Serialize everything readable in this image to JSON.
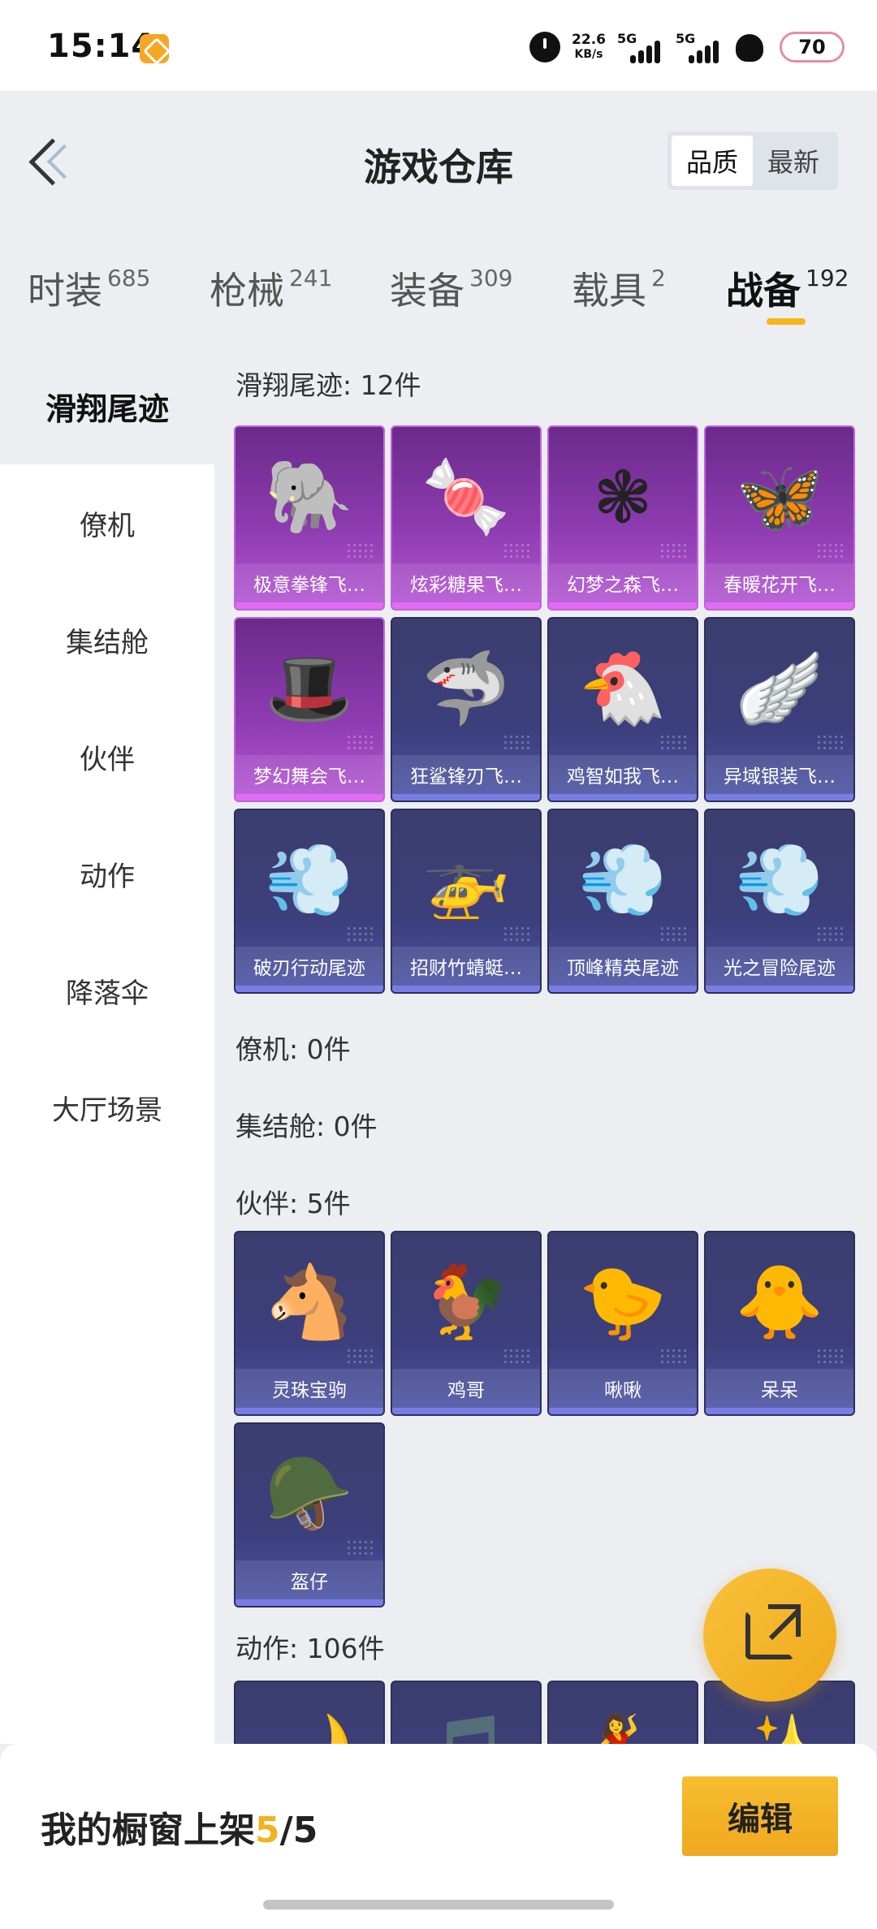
{
  "status_bar": {
    "time": "15:14",
    "speed_value": "22.6",
    "speed_unit": "KB/s",
    "sig1": "5G",
    "sig2": "5G",
    "battery": "70"
  },
  "header": {
    "title": "游戏仓库",
    "sort": [
      "品质",
      "最新"
    ],
    "sort_active": "品质"
  },
  "tabs": [
    {
      "label": "时装",
      "count": "685"
    },
    {
      "label": "枪械",
      "count": "241"
    },
    {
      "label": "装备",
      "count": "309"
    },
    {
      "label": "载具",
      "count": "2"
    },
    {
      "label": "战备",
      "count": "192"
    }
  ],
  "active_tab": "战备",
  "sidebar": [
    "滑翔尾迹",
    "僚机",
    "集结舱",
    "伙伴",
    "动作",
    "降落伞",
    "大厅场景"
  ],
  "sections": {
    "glide": {
      "title": "滑翔尾迹: 12件",
      "items": [
        {
          "label": "极意拳锋飞…",
          "icon": "elephant-boxer-icon",
          "glyph": "🐘",
          "rarity": "purple"
        },
        {
          "label": "炫彩糖果飞…",
          "icon": "candy-icon",
          "glyph": "🍬",
          "rarity": "purple"
        },
        {
          "label": "幻梦之森飞…",
          "icon": "crystal-flower-icon",
          "glyph": "❃",
          "rarity": "purple"
        },
        {
          "label": "春暖花开飞…",
          "icon": "butterfly-icon",
          "glyph": "🦋",
          "rarity": "purple"
        },
        {
          "label": "梦幻舞会飞…",
          "icon": "masquerade-hat-icon",
          "glyph": "🎩",
          "rarity": "purple"
        },
        {
          "label": "狂鲨锋刃飞…",
          "icon": "shark-icon",
          "glyph": "🦈",
          "rarity": "blue"
        },
        {
          "label": "鸡智如我飞…",
          "icon": "chicken-icon",
          "glyph": "🐔",
          "rarity": "blue"
        },
        {
          "label": "异域银装飞…",
          "icon": "silver-wing-icon",
          "glyph": "🪽",
          "rarity": "blue"
        },
        {
          "label": "破刃行动尾迹",
          "icon": "smoke-trail-icon",
          "glyph": "💨",
          "rarity": "blue"
        },
        {
          "label": "招财竹蜻蜓…",
          "icon": "bamboo-copter-icon",
          "glyph": "🚁",
          "rarity": "blue"
        },
        {
          "label": "顶峰精英尾迹",
          "icon": "elite-trail-icon",
          "glyph": "💨",
          "rarity": "blue"
        },
        {
          "label": "光之冒险尾迹",
          "icon": "light-trail-icon",
          "glyph": "💨",
          "rarity": "blue"
        }
      ]
    },
    "wingman": {
      "title": "僚机: 0件"
    },
    "pod": {
      "title": "集结舱: 0件"
    },
    "partner": {
      "title": "伙伴: 5件",
      "items": [
        {
          "label": "灵珠宝驹",
          "icon": "pony-partner-icon",
          "glyph": "🐴",
          "rarity": "blue"
        },
        {
          "label": "鸡哥",
          "icon": "chicken-partner-icon",
          "glyph": "🐓",
          "rarity": "blue"
        },
        {
          "label": "啾啾",
          "icon": "pink-bird-icon",
          "glyph": "🐤",
          "rarity": "blue"
        },
        {
          "label": "呆呆",
          "icon": "chick-partner-icon",
          "glyph": "🐥",
          "rarity": "blue"
        },
        {
          "label": "盔仔",
          "icon": "helmet-chick-icon",
          "glyph": "🪖",
          "rarity": "blue"
        }
      ]
    },
    "emote": {
      "title": "动作: 106件",
      "items": [
        {
          "label": "",
          "icon": "moon-emote-icon",
          "glyph": "🌙",
          "rarity": "blue"
        },
        {
          "label": "",
          "icon": "music-emote-icon",
          "glyph": "🎵",
          "rarity": "blue"
        },
        {
          "label": "",
          "icon": "dance-emote-icon",
          "glyph": "💃",
          "rarity": "blue"
        },
        {
          "label": "",
          "icon": "sparkle-emote-icon",
          "glyph": "✨",
          "rarity": "blue"
        }
      ]
    }
  },
  "bottom": {
    "prefix": "我的橱窗上架",
    "current": "5",
    "sep": "/",
    "total": "5",
    "edit": "编辑"
  },
  "colors": {
    "accent": "#f5b51e",
    "purple_card": "#8d3bb0",
    "blue_card": "#3c3f7c"
  }
}
